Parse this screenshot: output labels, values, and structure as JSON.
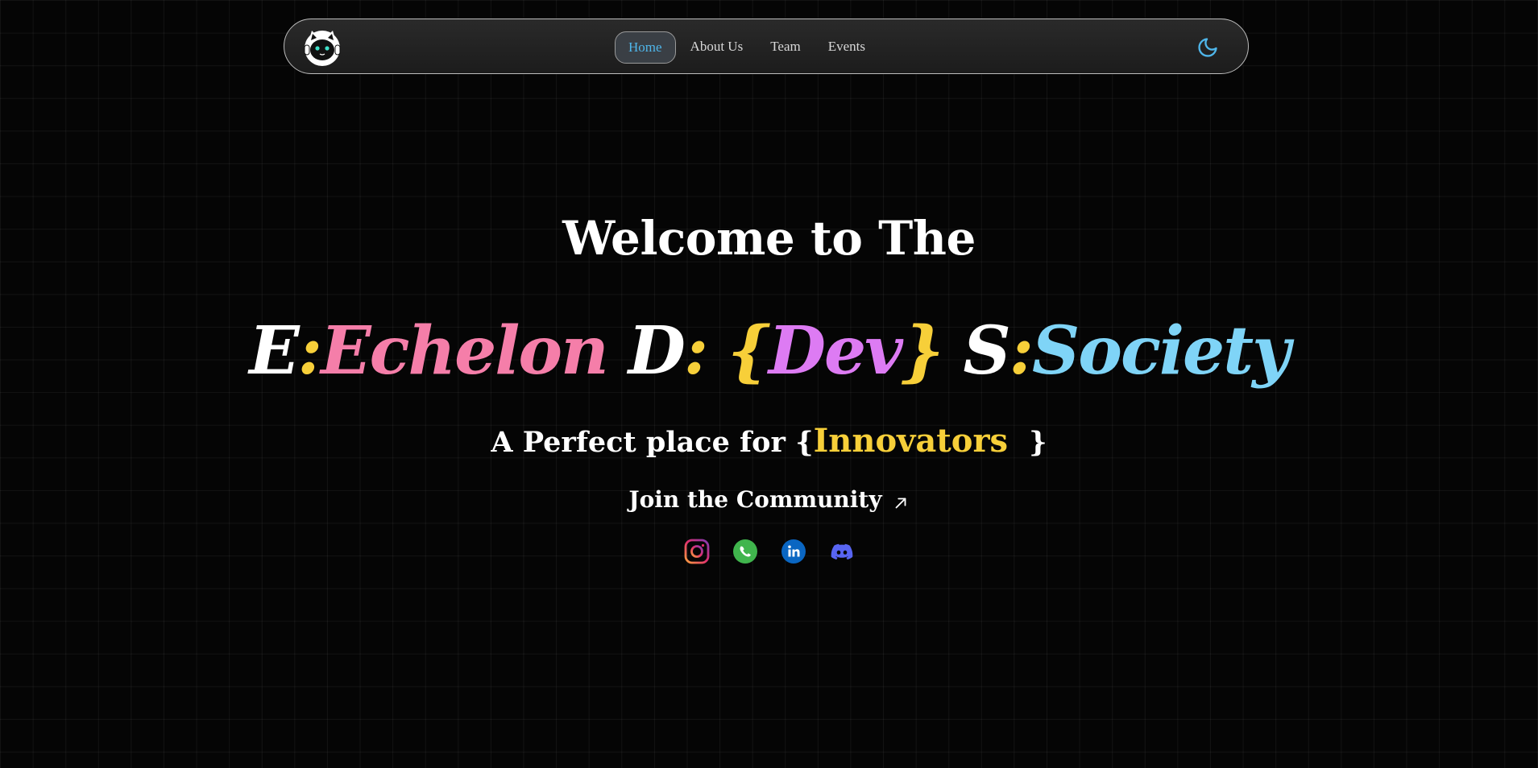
{
  "nav": {
    "logo_name": "cat-mascot-logo",
    "links": [
      {
        "label": "Home",
        "active": true
      },
      {
        "label": "About Us",
        "active": false
      },
      {
        "label": "Team",
        "active": false
      },
      {
        "label": "Events",
        "active": false
      }
    ],
    "theme_icon": "moon-icon"
  },
  "hero": {
    "welcome": "Welcome to The",
    "title": {
      "e_letter": "E",
      "e_colon": ":",
      "e_word": "Echelon",
      "d_letter": "D",
      "d_colon": ":",
      "d_open": "{",
      "d_word": "Dev",
      "d_close": "}",
      "s_letter": "S",
      "s_colon": ":",
      "s_word": "Society"
    },
    "tagline_prefix": "A Perfect place for {",
    "tagline_highlight": "Innovators",
    "tagline_suffix": "}",
    "cta": "Join the Community"
  },
  "socials": [
    {
      "name": "instagram-icon"
    },
    {
      "name": "whatsapp-icon"
    },
    {
      "name": "linkedin-icon"
    },
    {
      "name": "discord-icon"
    }
  ],
  "colors": {
    "background": "#050505",
    "accent_blue": "#4fb6ea",
    "yellow": "#f7cf39",
    "pink": "#f57ea9",
    "purple": "#dd7bf3",
    "sky": "#7fd4f7"
  }
}
